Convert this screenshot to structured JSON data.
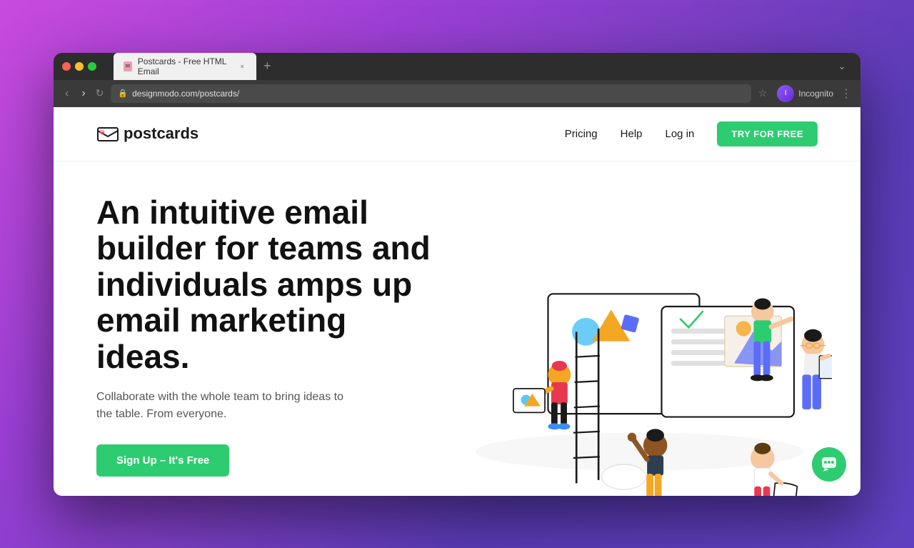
{
  "browser": {
    "tab_title": "Postcards - Free HTML Email",
    "url": "designmodo.com/postcards/",
    "back_btn": "‹",
    "forward_btn": "›",
    "refresh_btn": "↻",
    "lock_icon": "🔒",
    "bookmark_icon": "☆",
    "profile_label": "Incognito",
    "new_tab_btn": "+",
    "more_btn": "⋮",
    "tab_menu_btn": "⌄"
  },
  "nav": {
    "logo_text": "postcards",
    "pricing": "Pricing",
    "help": "Help",
    "login": "Log in",
    "try_free": "TRY FOR FREE"
  },
  "hero": {
    "title": "An intuitive email builder for teams and individuals amps up email marketing ideas.",
    "subtitle": "Collaborate with the whole team to bring ideas to the table. From everyone.",
    "cta": "Sign Up – It's Free"
  }
}
